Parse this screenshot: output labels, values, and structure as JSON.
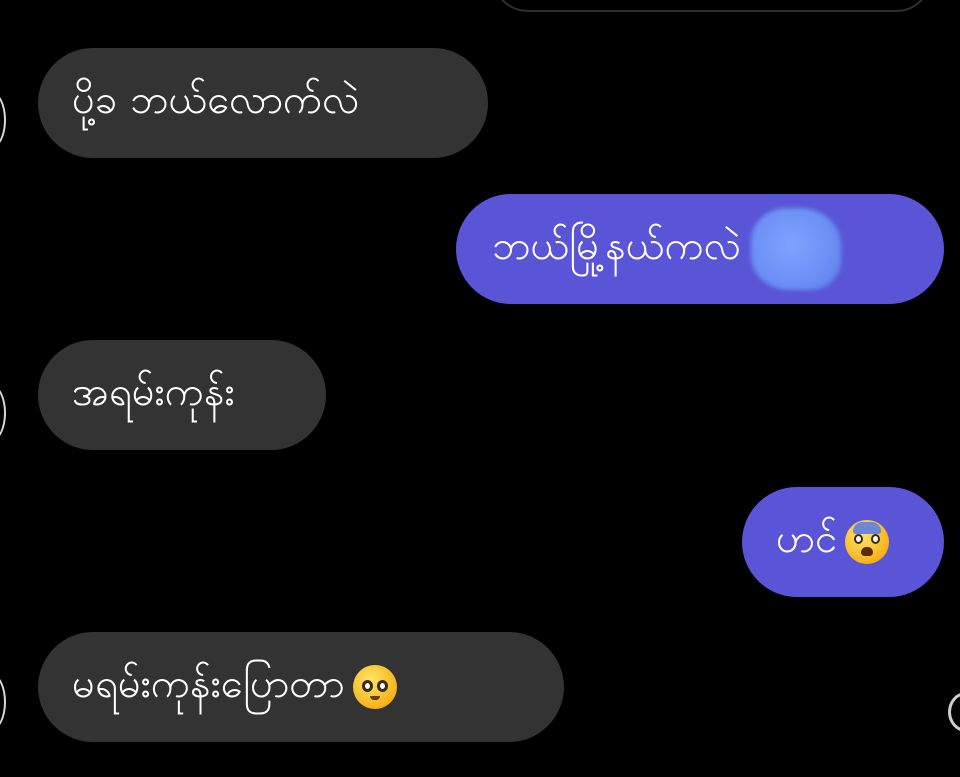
{
  "theme": {
    "background": "#000000",
    "incoming_bubble": "#333333",
    "outgoing_bubble": "#5a55d6",
    "text": "#ffffff"
  },
  "messages": [
    {
      "direction": "incoming",
      "text": "ပို့ခ ဘယ်လောက်လဲ"
    },
    {
      "direction": "outgoing",
      "text": "ဘယ်မြို့နယ်ကလဲ",
      "trailing": "redacted-sticker"
    },
    {
      "direction": "incoming",
      "text": "အရမ်းကုန်း"
    },
    {
      "direction": "outgoing",
      "text": "ဟင်",
      "trailing_emoji": "fearful-face"
    },
    {
      "direction": "incoming",
      "text": "မရမ်းကုန်းပြောတာ",
      "trailing_emoji": "pleading-face"
    }
  ]
}
